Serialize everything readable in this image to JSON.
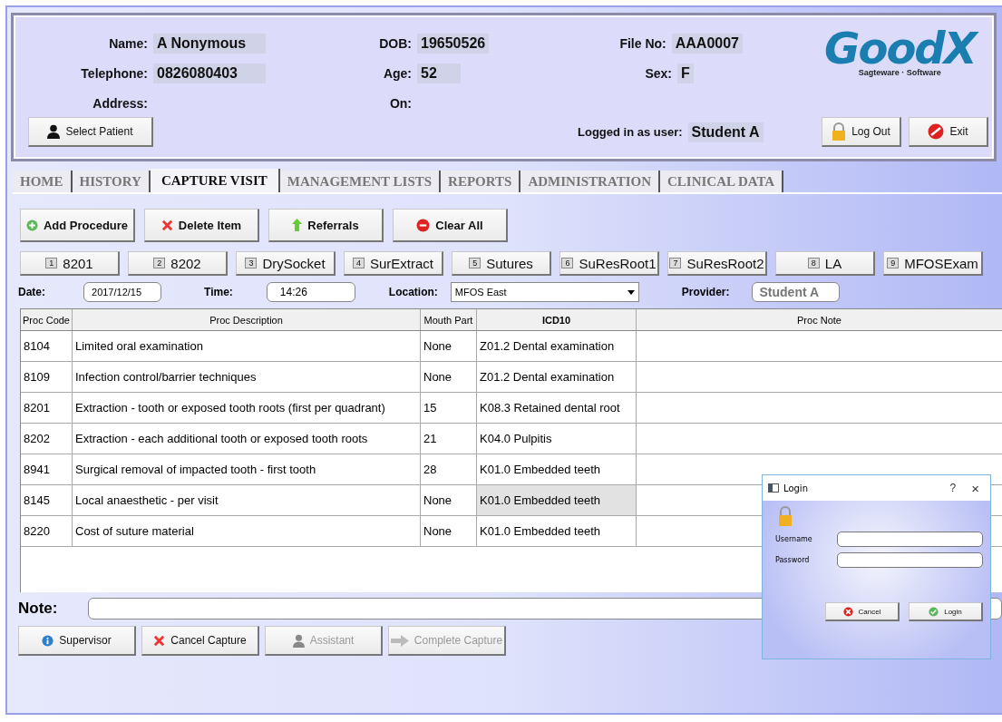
{
  "patient": {
    "fields": [
      {
        "label": "Name:",
        "value": "A Nonymous"
      },
      {
        "label": "Telephone:",
        "value": "0826080403"
      },
      {
        "label": "Address:"
      },
      {
        "label": "DOB:",
        "value": "19650526"
      },
      {
        "label": "Age:",
        "value": "52"
      },
      {
        "label": "On:"
      },
      {
        "label": "File No:",
        "value": "AAA0007"
      },
      {
        "label": "Sex:",
        "value": "F"
      }
    ],
    "select_button": "Select Patient",
    "logged_in_label": "Logged in as user:",
    "logged_in_user": "Student A"
  },
  "logo": {
    "text": "GoodX",
    "tagline": "Sagteware · Software"
  },
  "header_buttons": [
    {
      "label": "Log Out",
      "kind": "lock"
    },
    {
      "label": "Exit",
      "kind": "exit"
    }
  ],
  "tabs": [
    {
      "label": "HOME",
      "selected": false
    },
    {
      "label": "HISTORY",
      "selected": false
    },
    {
      "label": "CAPTURE VISIT",
      "selected": true
    },
    {
      "label": "MANAGEMENT LISTS",
      "selected": false
    },
    {
      "label": "REPORTS",
      "selected": false
    },
    {
      "label": "ADMINISTRATION",
      "selected": false
    },
    {
      "label": "CLINICAL DATA",
      "selected": false
    }
  ],
  "actions": [
    {
      "label": "Add Procedure",
      "kind": "add"
    },
    {
      "label": "Delete Item",
      "kind": "delete"
    },
    {
      "label": "Referrals",
      "kind": "up"
    },
    {
      "label": "Clear All",
      "kind": "clear"
    }
  ],
  "shortcuts": [
    {
      "key": "1",
      "label": "8201"
    },
    {
      "key": "2",
      "label": "8202"
    },
    {
      "key": "3",
      "label": "DrySocket"
    },
    {
      "key": "4",
      "label": "SurExtract"
    },
    {
      "key": "5",
      "label": "Sutures"
    },
    {
      "key": "6",
      "label": "SuResRoot1"
    },
    {
      "key": "7",
      "label": "SuResRoot2"
    },
    {
      "key": "8",
      "label": "LA"
    },
    {
      "key": "9",
      "label": "MFOSExam"
    }
  ],
  "visit": {
    "date_label": "Date:",
    "date": "2017/12/15",
    "time_label": "Time:",
    "time": "14:26",
    "location_label": "Location:",
    "location": "MFOS East",
    "provider_label": "Provider:",
    "provider": "Student A"
  },
  "table": {
    "columns": [
      "Proc Code",
      "Proc Description",
      "Mouth Part",
      "ICD10",
      "Proc Note"
    ],
    "rows": [
      {
        "code": "8104",
        "description": "Limited oral examination",
        "mouth_part": "None",
        "icd10": "Z01.2 Dental examination",
        "selected": false
      },
      {
        "code": "8109",
        "description": "Infection control/barrier techniques",
        "mouth_part": "None",
        "icd10": "Z01.2 Dental examination",
        "selected": false
      },
      {
        "code": "8201",
        "description": "Extraction - tooth or exposed tooth roots (first per quadrant)",
        "mouth_part": "15",
        "icd10": "K08.3 Retained dental root",
        "selected": false
      },
      {
        "code": "8202",
        "description": "Extraction - each additional tooth or exposed tooth roots",
        "mouth_part": "21",
        "icd10": "K04.0 Pulpitis",
        "selected": false
      },
      {
        "code": "8941",
        "description": "Surgical removal of impacted tooth - first tooth",
        "mouth_part": "28",
        "icd10": "K01.0 Embedded teeth",
        "selected": false
      },
      {
        "code": "8145",
        "description": "Local anaesthetic - per visit",
        "mouth_part": "None",
        "icd10": "K01.0 Embedded teeth",
        "selected": true
      },
      {
        "code": "8220",
        "description": "Cost of suture material",
        "mouth_part": "None",
        "icd10": "K01.0 Embedded teeth",
        "selected": false
      }
    ]
  },
  "note_label": "Note:",
  "bottom_buttons": [
    {
      "label": "Supervisor",
      "kind": "info",
      "disabled": false
    },
    {
      "label": "Cancel Capture",
      "kind": "delete",
      "disabled": false
    },
    {
      "label": "Assistant",
      "kind": "person",
      "disabled": true
    },
    {
      "label": "Complete Capture",
      "kind": "arrow",
      "disabled": true
    }
  ],
  "login_dialog": {
    "title": "Login",
    "help": "?",
    "close": "×",
    "username_label": "Username",
    "password_label": "Password",
    "cancel": "Cancel",
    "login": "Login"
  }
}
